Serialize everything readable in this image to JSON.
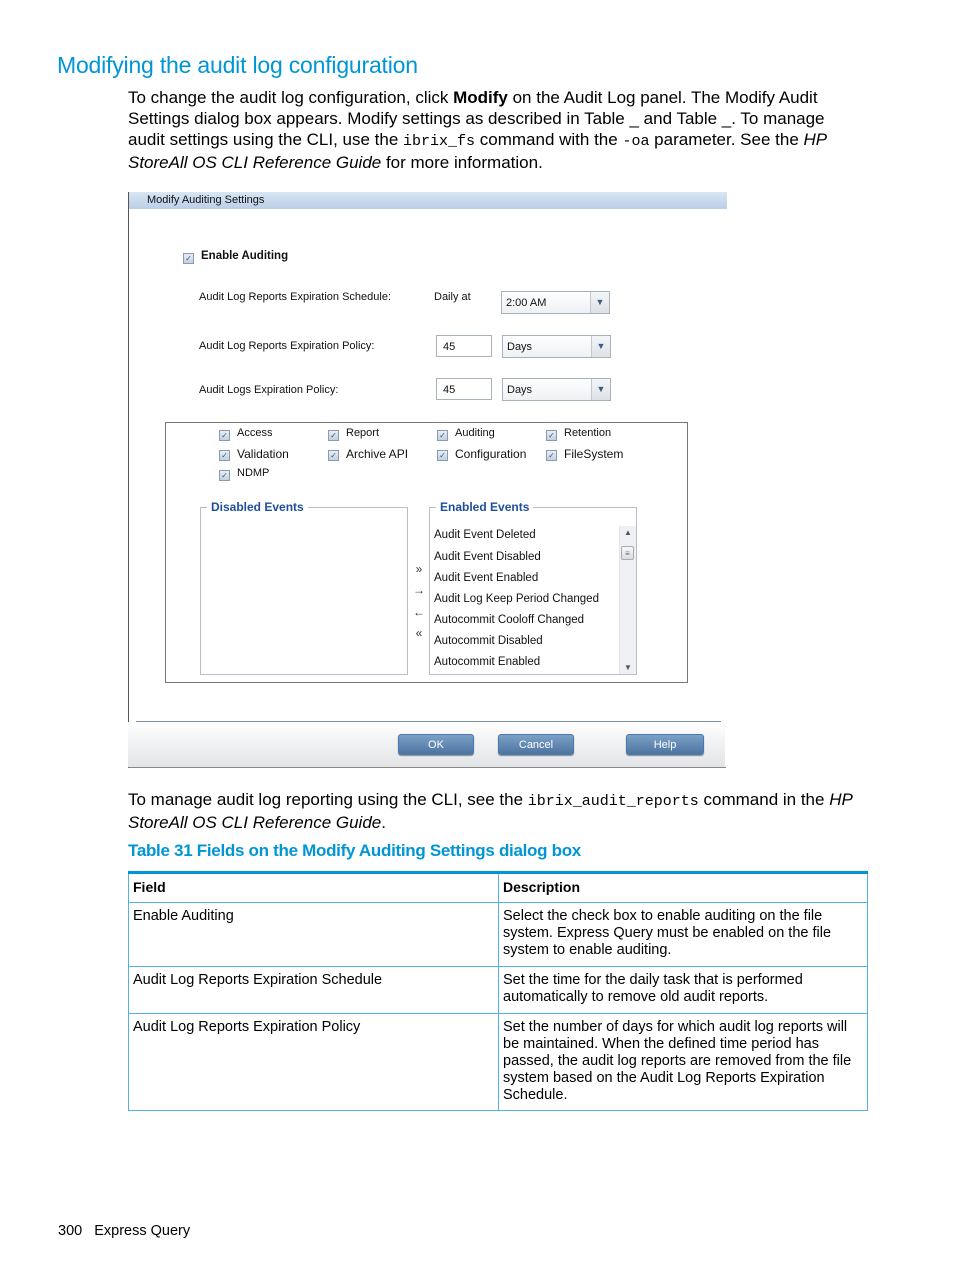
{
  "heading": "Modifying the audit log configuration",
  "intro": {
    "t1": "To change the audit log configuration, click ",
    "bold": "Modify",
    "t2": " on the Audit Log panel. The Modify Audit Settings dialog box appears. Modify settings as described in Table _ and Table _. To manage audit settings using the CLI, use the ",
    "code1": "ibrix_fs",
    "t3": " command with the ",
    "code2": "-oa",
    "t4": " parameter. See the ",
    "italic": "HP StoreAll OS CLI Reference Guide",
    "t5": " for more information."
  },
  "dialog": {
    "title": "Modify Auditing Settings",
    "enable_auditing": {
      "label": "Enable Auditing",
      "checked": true
    },
    "schedule": {
      "label": "Audit Log Reports Expiration Schedule:",
      "prefix": "Daily at",
      "value": "2:00 AM"
    },
    "reports_policy": {
      "label": "Audit Log Reports Expiration Policy:",
      "value": "45",
      "unit": "Days"
    },
    "logs_policy": {
      "label": "Audit Logs Expiration Policy:",
      "value": "45",
      "unit": "Days"
    },
    "categories": [
      {
        "label": "Access",
        "checked": true
      },
      {
        "label": "Report",
        "checked": true
      },
      {
        "label": "Auditing",
        "checked": true
      },
      {
        "label": "Retention",
        "checked": true
      },
      {
        "label": "Validation",
        "checked": true
      },
      {
        "label": "Archive API",
        "checked": true
      },
      {
        "label": "Configuration",
        "checked": true
      },
      {
        "label": "FileSystem",
        "checked": true
      },
      {
        "label": "NDMP",
        "checked": true
      }
    ],
    "disabled_events": {
      "title": "Disabled Events",
      "items": []
    },
    "enabled_events": {
      "title": "Enabled Events",
      "items": [
        "Audit Event Deleted",
        "Audit Event Disabled",
        "Audit Event Enabled",
        "Audit Log Keep Period Changed",
        "Autocommit Cooloff Changed",
        "Autocommit Disabled",
        "Autocommit Enabled"
      ]
    },
    "move_buttons": {
      "move_all_right": "»",
      "move_right": "→",
      "move_left": "←",
      "move_all_left": "«"
    },
    "buttons": {
      "ok": "OK",
      "cancel": "Cancel",
      "help": "Help"
    }
  },
  "cli_note": {
    "t1": "To manage audit log reporting using the CLI, see the ",
    "code": "ibrix_audit_reports",
    "t2": " command in the ",
    "italic": "HP StoreAll OS CLI Reference Guide",
    "t3": "."
  },
  "table": {
    "caption": "Table 31 Fields on the Modify Auditing Settings dialog box",
    "headers": [
      "Field",
      "Description"
    ],
    "rows": [
      [
        "Enable Auditing",
        "Select the check box to enable auditing on the file system. Express Query must be enabled on the file system to enable auditing."
      ],
      [
        "Audit Log Reports Expiration Schedule",
        "Set the time for the daily task that is performed automatically to remove old audit reports."
      ],
      [
        "Audit Log Reports Expiration Policy",
        "Set the number of days for which audit log reports will be maintained. When the defined time period has passed, the audit log reports are removed from the file system based on the Audit Log Reports Expiration Schedule."
      ]
    ]
  },
  "footer": {
    "page_number": "300",
    "section": "Express Query"
  }
}
